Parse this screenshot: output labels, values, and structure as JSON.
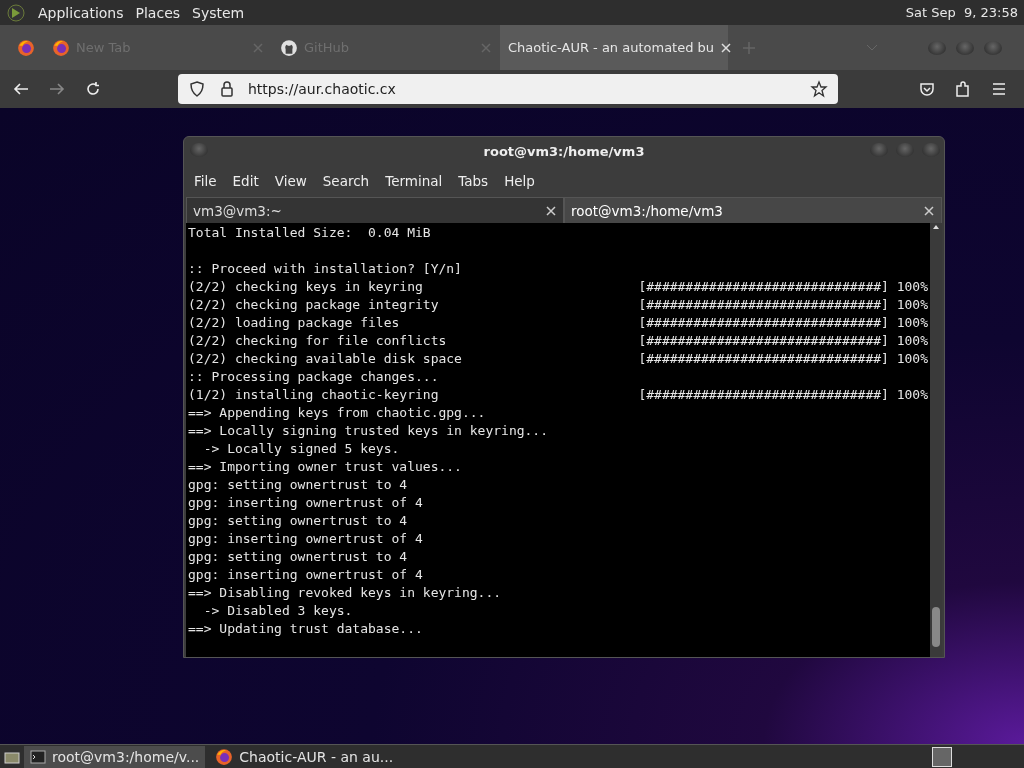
{
  "top_panel": {
    "menus": [
      "Applications",
      "Places",
      "System"
    ],
    "clock": "Sat Sep  9, 23:58"
  },
  "browser": {
    "tabs": [
      {
        "title": "New Tab",
        "selected": false
      },
      {
        "title": "GitHub",
        "selected": false
      },
      {
        "title": "Chaotic-AUR - an automated bu",
        "selected": true
      }
    ],
    "url": "https://aur.chaotic.cx"
  },
  "terminal": {
    "title": "root@vm3:/home/vm3",
    "menus": [
      "File",
      "Edit",
      "View",
      "Search",
      "Terminal",
      "Tabs",
      "Help"
    ],
    "tabs": [
      {
        "title": "vm3@vm3:~",
        "selected": false
      },
      {
        "title": "root@vm3:/home/vm3",
        "selected": true
      }
    ],
    "lines": [
      {
        "text": "Total Installed Size:  0.04 MiB"
      },
      {
        "text": ":: Proceed with installation? [Y/n]",
        "blank_line_before": true
      },
      {
        "text": "(2/2) checking keys in keyring",
        "bar": "[##############################]",
        "percent": "100%"
      },
      {
        "text": "(2/2) checking package integrity",
        "bar": "[##############################]",
        "percent": "100%"
      },
      {
        "text": "(2/2) loading package files",
        "bar": "[##############################]",
        "percent": "100%"
      },
      {
        "text": "(2/2) checking for file conflicts",
        "bar": "[##############################]",
        "percent": "100%"
      },
      {
        "text": "(2/2) checking available disk space",
        "bar": "[##############################]",
        "percent": "100%"
      },
      {
        "text": ":: Processing package changes..."
      },
      {
        "text": "(1/2) installing chaotic-keyring",
        "bar": "[##############################]",
        "percent": "100%"
      },
      {
        "text": "==> Appending keys from chaotic.gpg..."
      },
      {
        "text": "==> Locally signing trusted keys in keyring..."
      },
      {
        "text": "  -> Locally signed 5 keys."
      },
      {
        "text": "==> Importing owner trust values..."
      },
      {
        "text": "gpg: setting ownertrust to 4"
      },
      {
        "text": "gpg: inserting ownertrust of 4"
      },
      {
        "text": "gpg: setting ownertrust to 4"
      },
      {
        "text": "gpg: inserting ownertrust of 4"
      },
      {
        "text": "gpg: setting ownertrust to 4"
      },
      {
        "text": "gpg: inserting ownertrust of 4"
      },
      {
        "text": "==> Disabling revoked keys in keyring..."
      },
      {
        "text": "  -> Disabled 3 keys."
      },
      {
        "text": "==> Updating trust database..."
      }
    ]
  },
  "taskbar": {
    "tasks": [
      {
        "title": "root@vm3:/home/v...",
        "selected": true
      },
      {
        "title": "Chaotic-AUR - an au...",
        "selected": false
      }
    ]
  }
}
